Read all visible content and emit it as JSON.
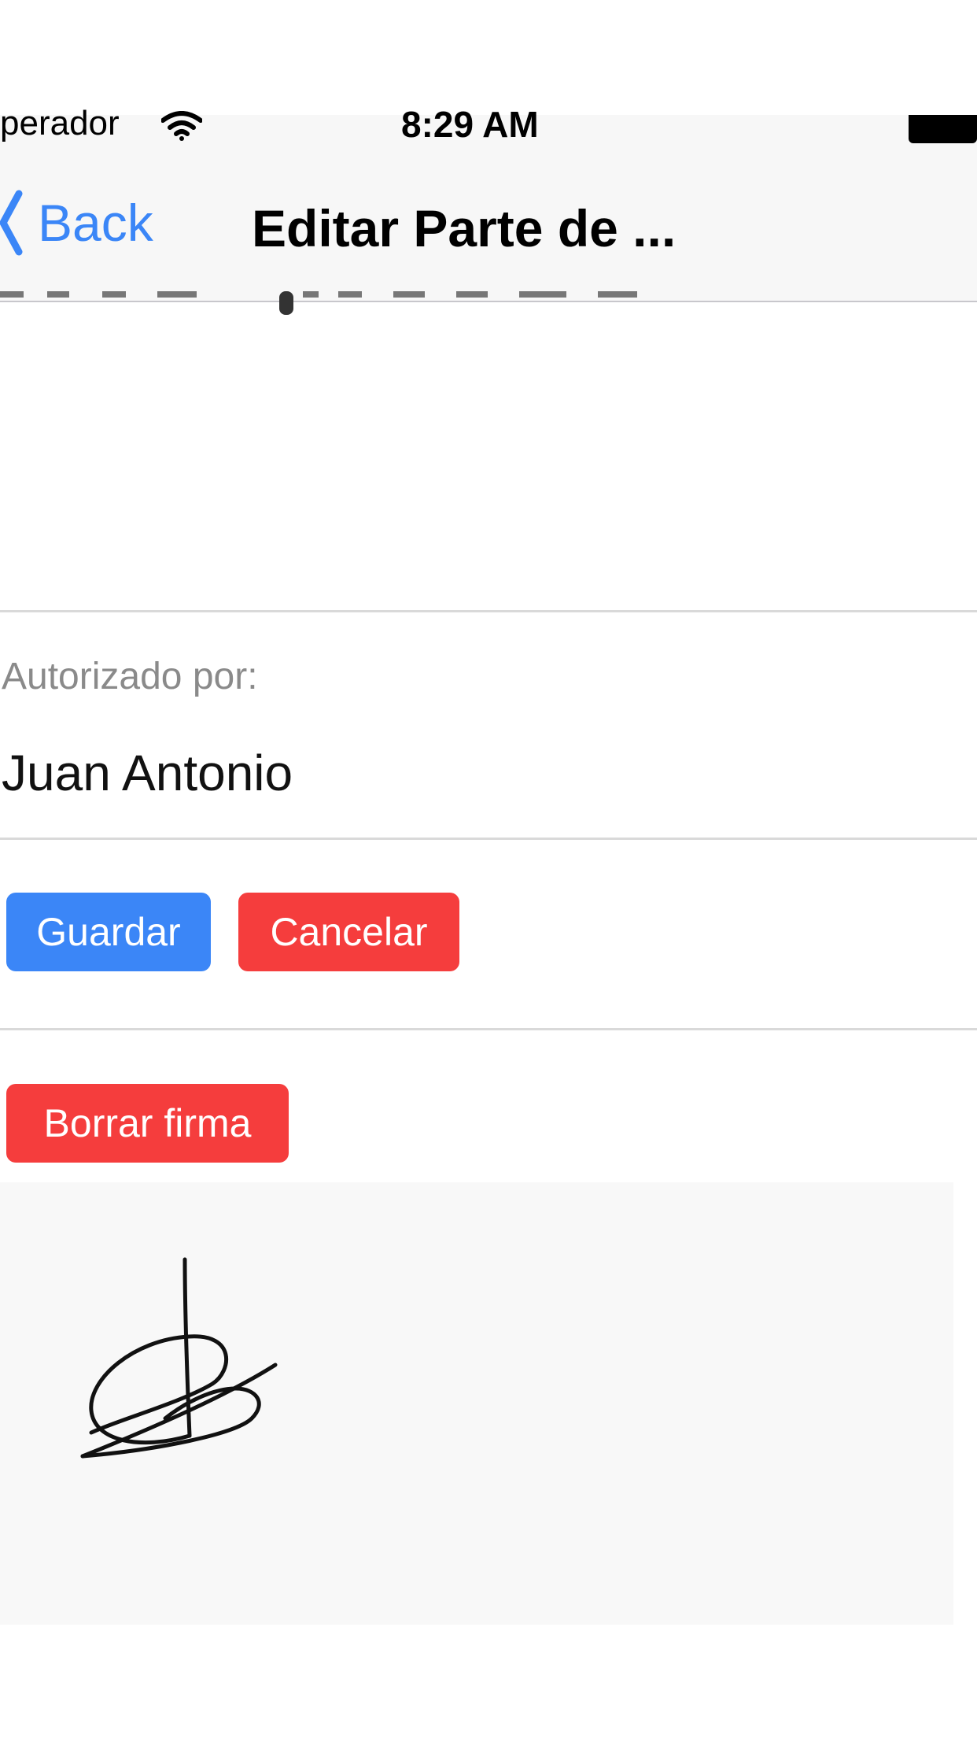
{
  "status_bar": {
    "carrier": "perador",
    "time": "8:29 AM",
    "wifi_icon": "wifi-icon",
    "battery_icon": "battery-icon"
  },
  "nav_bar": {
    "back_label": "Back",
    "back_icon": "chevron-left-icon",
    "title": "Editar Parte de ..."
  },
  "authorized": {
    "label": "Autorizado por:",
    "value": "Juan Antonio"
  },
  "actions": {
    "save_label": "Guardar",
    "cancel_label": "Cancelar"
  },
  "signature": {
    "clear_label": "Borrar firma"
  },
  "colors": {
    "accent": "#3b86f7",
    "danger": "#f53d3d",
    "nav_background": "#f7f7f7",
    "signature_background": "#f8f8f8"
  }
}
